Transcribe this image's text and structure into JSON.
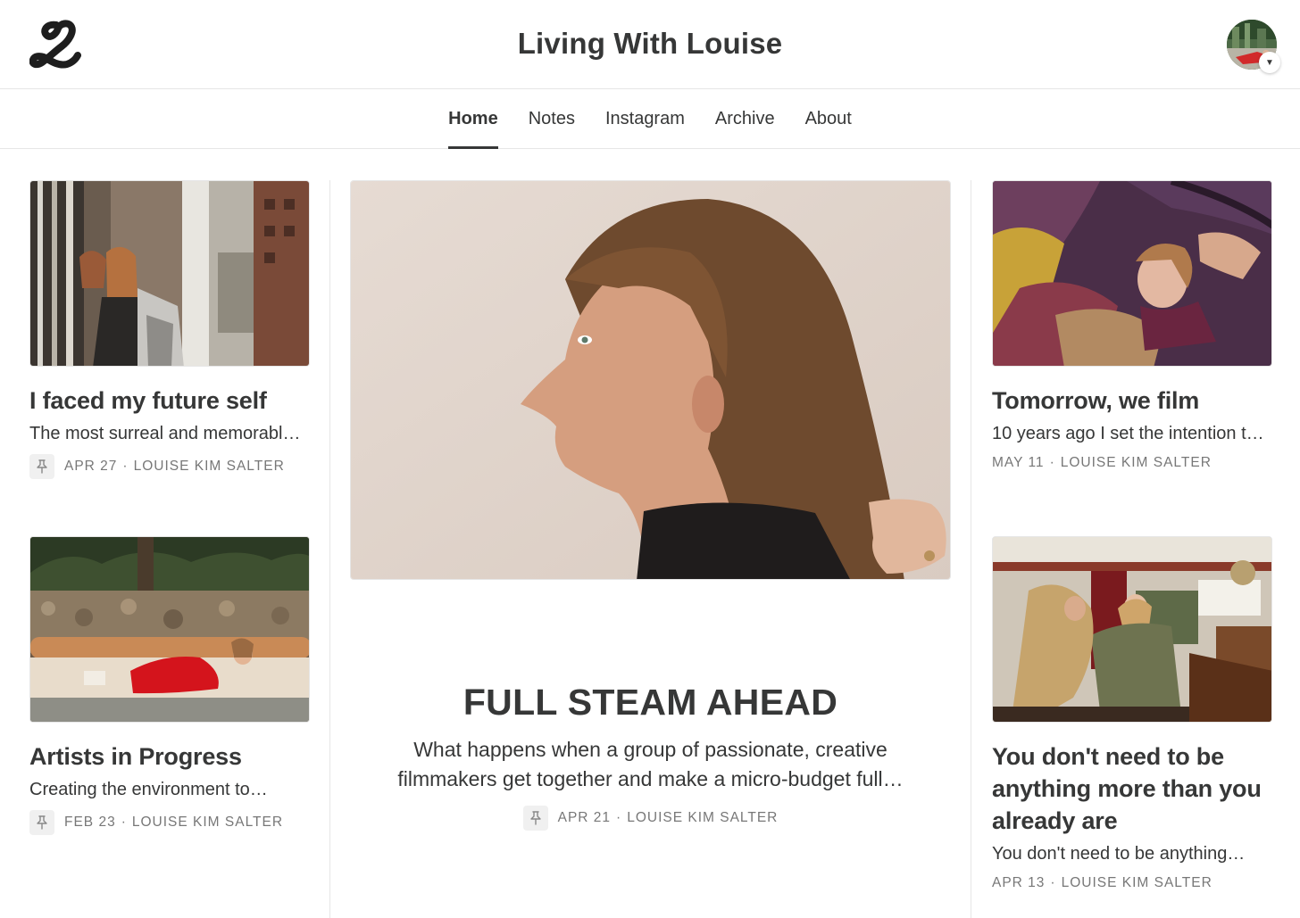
{
  "header": {
    "logo_icon": "script-L-logo-icon",
    "title": "Living With Louise",
    "avatar_icon": "user-avatar-icon",
    "caret_icon": "caret-down-icon"
  },
  "nav": {
    "items": [
      {
        "label": "Home",
        "active": true
      },
      {
        "label": "Notes",
        "active": false
      },
      {
        "label": "Instagram",
        "active": false
      },
      {
        "label": "Archive",
        "active": false
      },
      {
        "label": "About",
        "active": false
      }
    ]
  },
  "posts": {
    "left_top": {
      "title": "I faced my future self",
      "subtitle": "The most surreal and memorable…",
      "pinned": true,
      "date": "APR 27",
      "author": "LOUISE KIM SALTER"
    },
    "left_bottom": {
      "title": "Artists in Progress",
      "subtitle": "Creating the environment to…",
      "pinned": true,
      "date": "FEB 23",
      "author": "LOUISE KIM SALTER"
    },
    "featured": {
      "title": "FULL STEAM AHEAD",
      "subtitle": "What happens when a group of passionate, creative filmmakers get together and make a micro-budget full…",
      "pinned": true,
      "date": "APR 21",
      "author": "LOUISE KIM SALTER"
    },
    "right_top": {
      "title": "Tomorrow, we film",
      "subtitle": "10 years ago I set the intention to…",
      "pinned": false,
      "date": "MAY 11",
      "author": "LOUISE KIM SALTER"
    },
    "right_bottom": {
      "title": "You don't need to be anything more than you already are",
      "subtitle": "You don't need to be anything…",
      "pinned": false,
      "date": "APR 13",
      "author": "LOUISE KIM SALTER"
    }
  },
  "separator": "·",
  "colors": {
    "text": "#363737",
    "meta": "#777777",
    "border": "#e6e6e6",
    "pin_bg": "#f0f0f0"
  }
}
